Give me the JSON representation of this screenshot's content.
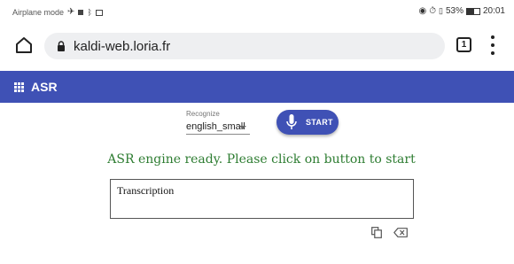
{
  "status_bar": {
    "left_text": "Airplane mode",
    "battery": "53%",
    "time": "20:01"
  },
  "browser": {
    "url": "kaldi-web.loria.fr",
    "tab_count": "1"
  },
  "app": {
    "title": "ASR"
  },
  "recognizer": {
    "label": "Recognize",
    "selected": "english_small"
  },
  "start_button": {
    "label": "START"
  },
  "status_message": "ASR engine ready. Please click on button to start",
  "transcription": {
    "label": "Transcription"
  },
  "colors": {
    "primary": "#3f51b5",
    "success": "#2e7d32"
  },
  "icons": [
    "home-icon",
    "lock-icon",
    "tabs-icon",
    "menu-icon",
    "apps-icon",
    "mic-icon",
    "copy-icon",
    "backspace-icon"
  ]
}
